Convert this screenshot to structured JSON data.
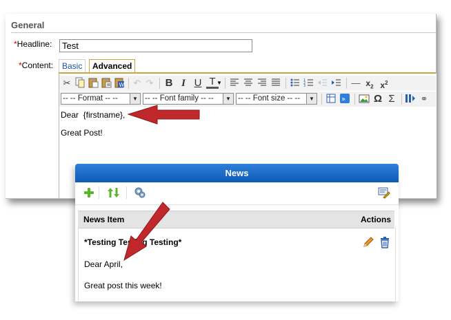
{
  "editor": {
    "section_title": "General",
    "headline_label": "Headline:",
    "required_mark": "*",
    "headline_value": "Test",
    "content_label": "Content:",
    "tabs": [
      {
        "label": "Basic",
        "active": false
      },
      {
        "label": "Advanced",
        "active": true
      }
    ],
    "toolbar_icons_row1": [
      "cut-icon",
      "copy-icon",
      "paste-icon",
      "paste-text-icon",
      "paste-word-icon",
      "undo-icon",
      "redo-icon",
      "bold-icon",
      "italic-icon",
      "underline-icon",
      "text-color-icon",
      "align-left-icon",
      "align-center-icon",
      "align-right-icon",
      "align-justify-icon",
      "bullet-list-icon",
      "numbered-list-icon",
      "outdent-icon",
      "indent-icon",
      "horizontal-rule-icon",
      "subscript-icon",
      "superscript-icon"
    ],
    "toolbar_glyphs": {
      "bold": "B",
      "italic": "I",
      "underline": "U",
      "text_color": "T"
    },
    "format_select": "-- -- Format -- --",
    "font_family_select": "-- -- Font family -- --",
    "font_size_select": "-- -- Font size -- --",
    "body_line1": "Dear  {firstname},",
    "body_line2": "Great Post!"
  },
  "news": {
    "header_title": "News",
    "columns": {
      "item": "News Item",
      "actions": "Actions"
    },
    "row_title": "*Testing Testing Testing*",
    "row_line1": "Dear April,",
    "row_line2": "Great post this week!"
  },
  "colors": {
    "arrow": "#c0282b",
    "header_blue": "#1565c0",
    "tab_border": "#c9a640"
  }
}
